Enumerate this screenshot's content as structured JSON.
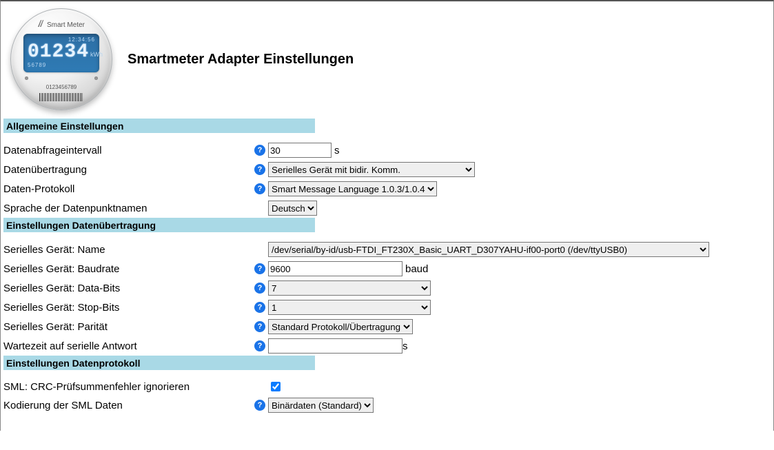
{
  "header": {
    "title": "Smartmeter Adapter Einstellungen",
    "logo": {
      "brand": "Smart Meter",
      "lcd_time": "12:34:56",
      "lcd_value": "01234",
      "lcd_unit": "kWh",
      "lcd_sub": "56789",
      "serial": "0123456789"
    }
  },
  "sections": {
    "general": {
      "title": "Allgemeine Einstellungen",
      "interval_label": "Datenabfrageintervall",
      "interval_value": "30",
      "interval_unit": "s",
      "transport_label": "Datenübertragung",
      "transport_value": "Serielles Gerät mit bidir. Komm.",
      "protocol_label": "Daten-Protokoll",
      "protocol_value": "Smart Message Language 1.0.3/1.0.4",
      "language_label": "Sprache der Datenpunktnamen",
      "language_value": "Deutsch"
    },
    "transport": {
      "title": "Einstellungen Datenübertragung",
      "device_label": "Serielles Gerät: Name",
      "device_value": "/dev/serial/by-id/usb-FTDI_FT230X_Basic_UART_D307YAHU-if00-port0 (/dev/ttyUSB0)",
      "baud_label": "Serielles Gerät: Baudrate",
      "baud_value": "9600",
      "baud_unit": "baud",
      "databits_label": "Serielles Gerät: Data-Bits",
      "databits_value": "7",
      "stopbits_label": "Serielles Gerät: Stop-Bits",
      "stopbits_value": "1",
      "parity_label": "Serielles Gerät: Parität",
      "parity_value": "Standard Protokoll/Übertragung",
      "wait_label": "Wartezeit auf serielle Antwort",
      "wait_value": "",
      "wait_unit": "s"
    },
    "protocol": {
      "title": "Einstellungen Datenprotokoll",
      "crc_label": "SML: CRC-Prüfsummenfehler ignorieren",
      "crc_checked": true,
      "encoding_label": "Kodierung der SML Daten",
      "encoding_value": "Binärdaten (Standard)"
    }
  }
}
